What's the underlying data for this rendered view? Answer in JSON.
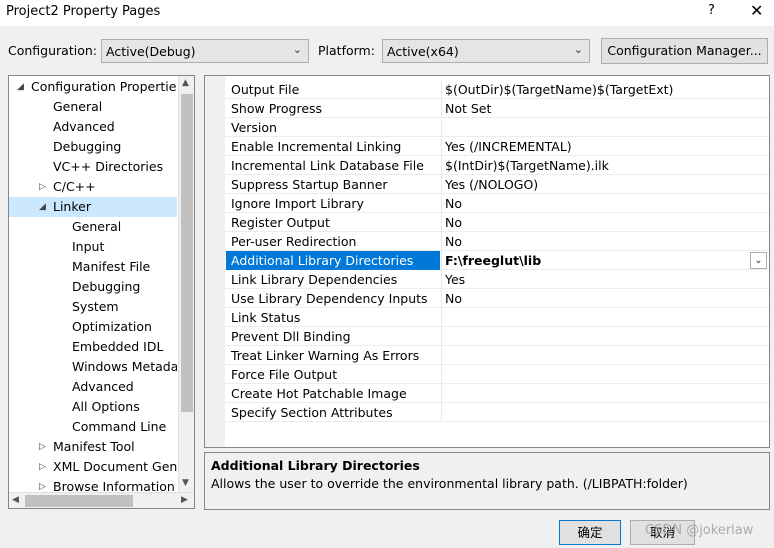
{
  "window": {
    "title": "Project2 Property Pages",
    "help": "?",
    "close": "✕"
  },
  "config_bar": {
    "configuration_label": "Configuration:",
    "configuration_value": "Active(Debug)",
    "platform_label": "Platform:",
    "platform_value": "Active(x64)",
    "manager_button": "Configuration Manager..."
  },
  "tree": {
    "items": [
      {
        "label": "Configuration Properties",
        "arrow": "◢"
      },
      {
        "label": "General"
      },
      {
        "label": "Advanced"
      },
      {
        "label": "Debugging"
      },
      {
        "label": "VC++ Directories"
      },
      {
        "label": "C/C++",
        "arrow": "▷"
      },
      {
        "label": "Linker",
        "arrow": "◢",
        "selected": true
      },
      {
        "label": "General"
      },
      {
        "label": "Input"
      },
      {
        "label": "Manifest File"
      },
      {
        "label": "Debugging"
      },
      {
        "label": "System"
      },
      {
        "label": "Optimization"
      },
      {
        "label": "Embedded IDL"
      },
      {
        "label": "Windows Metada"
      },
      {
        "label": "Advanced"
      },
      {
        "label": "All Options"
      },
      {
        "label": "Command Line"
      },
      {
        "label": "Manifest Tool",
        "arrow": "▷"
      },
      {
        "label": "XML Document Gene",
        "arrow": "▷"
      },
      {
        "label": "Browse Information",
        "arrow": "▷"
      }
    ]
  },
  "properties": [
    {
      "name": "Output File",
      "value": "$(OutDir)$(TargetName)$(TargetExt)"
    },
    {
      "name": "Show Progress",
      "value": "Not Set"
    },
    {
      "name": "Version",
      "value": ""
    },
    {
      "name": "Enable Incremental Linking",
      "value": "Yes (/INCREMENTAL)"
    },
    {
      "name": "Incremental Link Database File",
      "value": "$(IntDir)$(TargetName).ilk"
    },
    {
      "name": "Suppress Startup Banner",
      "value": "Yes (/NOLOGO)"
    },
    {
      "name": "Ignore Import Library",
      "value": "No"
    },
    {
      "name": "Register Output",
      "value": "No"
    },
    {
      "name": "Per-user Redirection",
      "value": "No"
    },
    {
      "name": "Additional Library Directories",
      "value": "F:\\freeglut\\lib",
      "selected": true
    },
    {
      "name": "Link Library Dependencies",
      "value": "Yes"
    },
    {
      "name": "Use Library Dependency Inputs",
      "value": "No"
    },
    {
      "name": "Link Status",
      "value": ""
    },
    {
      "name": "Prevent Dll Binding",
      "value": ""
    },
    {
      "name": "Treat Linker Warning As Errors",
      "value": ""
    },
    {
      "name": "Force File Output",
      "value": ""
    },
    {
      "name": "Create Hot Patchable Image",
      "value": ""
    },
    {
      "name": "Specify Section Attributes",
      "value": ""
    }
  ],
  "description": {
    "title": "Additional Library Directories",
    "text": "Allows the user to override the environmental library path. (/LIBPATH:folder)"
  },
  "buttons": {
    "ok": "确定",
    "cancel": "取消"
  },
  "watermark": "CSDN @jokerlaw"
}
